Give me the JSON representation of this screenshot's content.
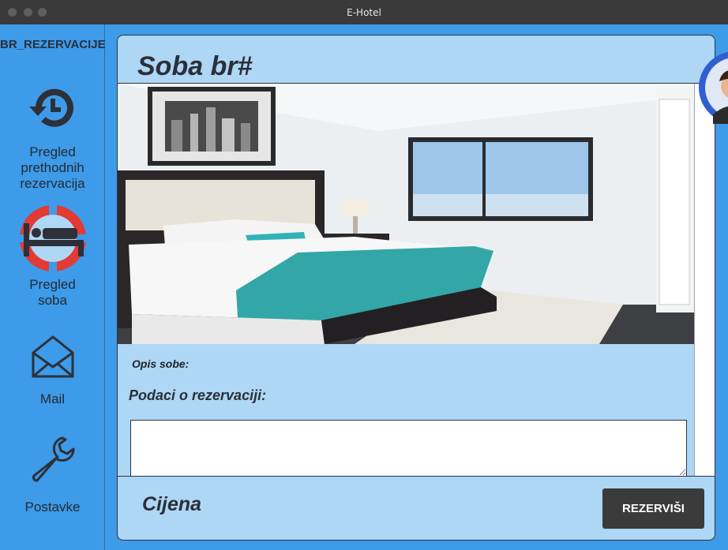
{
  "window": {
    "title": "E-Hotel"
  },
  "sidebar": {
    "reservation_id": "BR_REZERVACIJE",
    "items": [
      {
        "label_line1": "Pregled",
        "label_line2": "prethodnih",
        "label_line3": "rezervacija",
        "icon": "history-icon"
      },
      {
        "label_line1": "Pregled",
        "label_line2": "soba",
        "icon": "bed-icon",
        "active": true
      },
      {
        "label_line1": "Mail",
        "icon": "envelope-icon"
      },
      {
        "label_line1": "Postavke",
        "icon": "wrench-icon"
      }
    ]
  },
  "room": {
    "title": "Soba br#",
    "description_label": "Opis sobe:",
    "reservation_data_label": "Podaci o rezervaciji:",
    "reservation_data_value": "",
    "price_label": "Cijena",
    "reserve_button": "REZERVIŠI"
  },
  "colors": {
    "sidebar": "#3d9be9",
    "panel": "#aed6f5",
    "active_icon": "#e23a34",
    "button": "#3b3b3b"
  }
}
